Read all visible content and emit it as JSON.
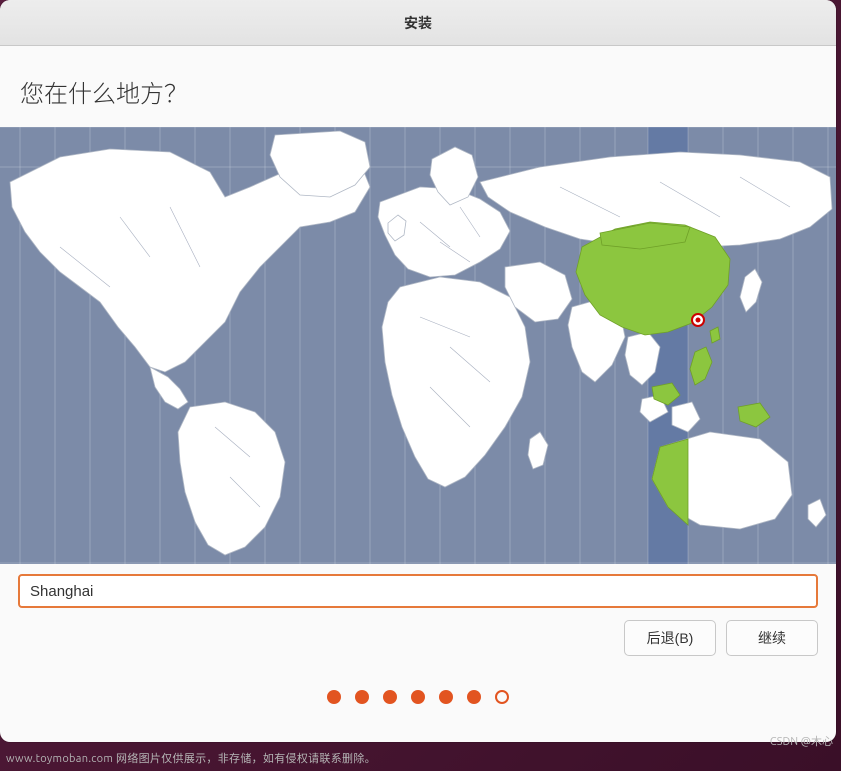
{
  "window": {
    "title": "安装"
  },
  "question": "您在什么地方？",
  "timezone_input": {
    "value": "Shanghai"
  },
  "buttons": {
    "back": "后退(B)",
    "continue": "继续"
  },
  "map": {
    "selected_region": "China",
    "pin_label": "Shanghai"
  },
  "progress": {
    "total_steps": 7,
    "current_step": 7
  },
  "watermarks": {
    "bottom": "www.toymoban.com 网络图片仅供展示，非存储，如有侵权请联系删除。",
    "right": "CSDN @木心"
  }
}
